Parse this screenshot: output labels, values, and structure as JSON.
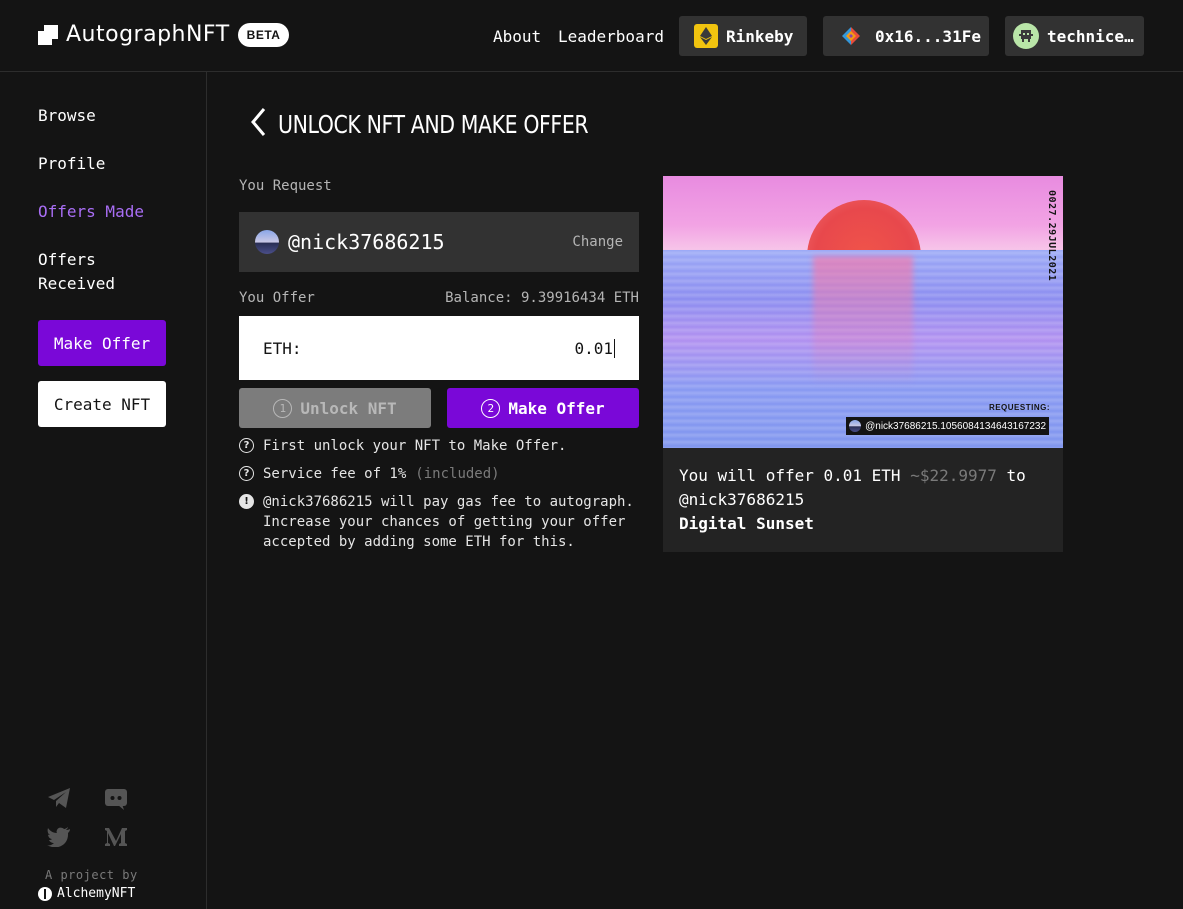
{
  "header": {
    "logo_text": "AutographNFT",
    "beta_badge": "BETA",
    "nav": {
      "about": "About",
      "leaderboard": "Leaderboard"
    },
    "network": {
      "label": "Rinkeby",
      "icon": "ethereum-icon",
      "icon_color": "#f1c40f"
    },
    "wallet": {
      "address": "0x16...31Fe",
      "icon": "wallet-avatar-icon"
    },
    "user": {
      "name": "technice…",
      "icon": "alien-avatar-icon",
      "icon_color": "#b9e5a8"
    }
  },
  "sidebar": {
    "items": [
      {
        "label": "Browse",
        "active": false
      },
      {
        "label": "Profile",
        "active": false
      },
      {
        "label": "Offers Made",
        "active": true
      },
      {
        "label": "Offers Received",
        "active": false
      }
    ],
    "make_offer_button": "Make Offer",
    "create_nft_button": "Create NFT",
    "social": [
      "telegram-icon",
      "discord-icon",
      "twitter-icon",
      "medium-icon"
    ],
    "project_by": "A project by",
    "alchemy": "AlchemyNFT"
  },
  "main": {
    "title": "UNLOCK NFT AND MAKE OFFER",
    "you_request_label": "You Request",
    "request_handle": "@nick37686215",
    "change_label": "Change",
    "you_offer_label": "You Offer",
    "balance_label": "Balance: 9.39916434 ETH",
    "eth_label": "ETH:",
    "eth_value": "0.01",
    "unlock_step": "1",
    "unlock_label": "Unlock NFT",
    "offer_step": "2",
    "offer_label": "Make Offer",
    "notes": {
      "first": "First unlock your NFT to Make Offer.",
      "fee": "Service fee of 1%",
      "fee_included": "(included)",
      "gas": "@nick37686215 will pay gas fee to autograph. Increase your chances of getting your offer accepted by adding some ETH for this."
    }
  },
  "nft": {
    "date": "0027.29JUL2021",
    "requesting_label": "REQUESTING:",
    "tag": "@nick37686215.1056084134643167232",
    "offer_prefix": "You will offer 0.01 ETH",
    "offer_usd": "~$22.9977",
    "offer_to": "to",
    "recipient": "@nick37686215",
    "title": "Digital Sunset"
  },
  "colors": {
    "accent": "#7a08d8",
    "active_link": "#a96ef5",
    "background": "#141414",
    "panel": "#323232"
  }
}
